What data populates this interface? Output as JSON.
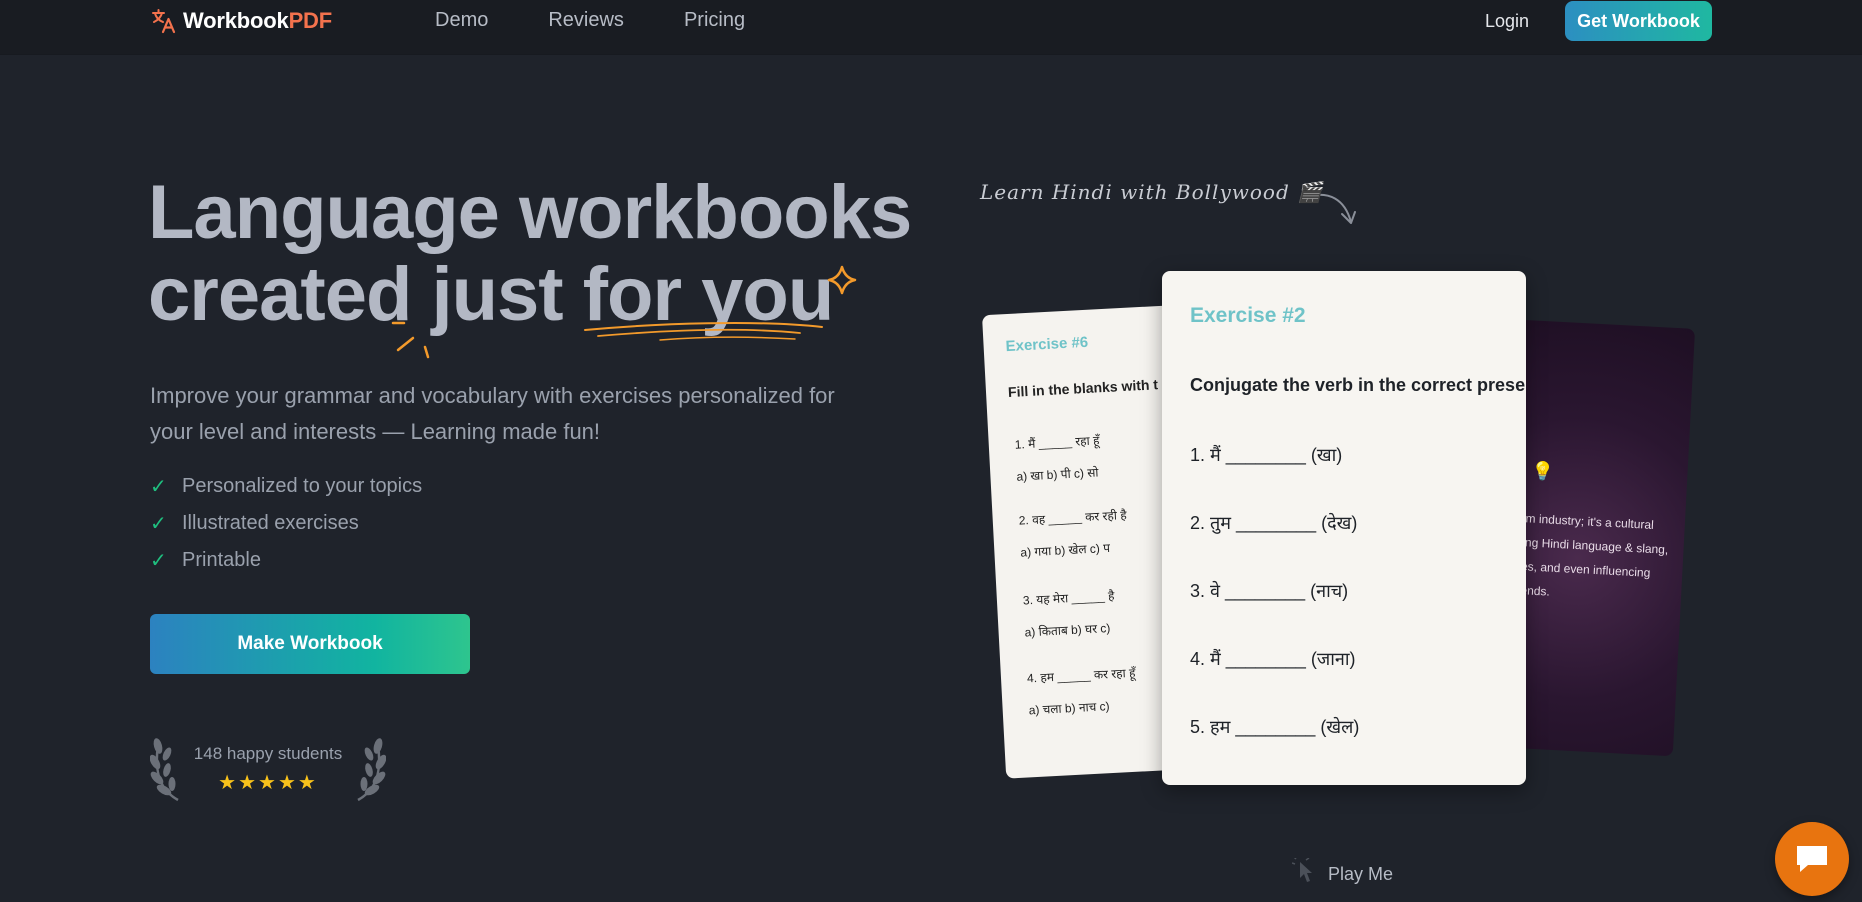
{
  "nav": {
    "logo_prefix": "Workbook",
    "logo_accent": "PDF",
    "links": [
      "Demo",
      "Reviews",
      "Pricing"
    ],
    "login": "Login",
    "cta": "Get Workbook"
  },
  "hero": {
    "headline_line1": "Language workbooks",
    "headline_line2": "created just for you",
    "subtitle": "Improve your grammar and vocabulary with exercises personalized for your level and interests — Learning made fun!",
    "features": [
      "Personalized to your topics",
      "Illustrated exercises",
      "Printable"
    ],
    "cta": "Make Workbook",
    "students": "148 happy students",
    "stars": "★★★★★"
  },
  "preview": {
    "handwritten": "Learn Hindi with Bollywood 🎬",
    "card_left": {
      "title": "Exercise #6",
      "instruction": "Fill in the blanks with t",
      "questions": [
        {
          "q": "1.  मैं _____ रहा हूँ",
          "opts": "a) खा    b) पी    c) सो"
        },
        {
          "q": "2.  वह _____ कर रही है",
          "opts": "a) गया    b) खेल    c) प"
        },
        {
          "q": "3.  यह मेरा _____ है",
          "opts": "a) किताब    b) घर    c)"
        },
        {
          "q": "4.  हम _____ कर रहा हूँ",
          "opts": "a) चला    b) नाच    c)"
        }
      ]
    },
    "card_main": {
      "title": "Exercise #2",
      "instruction": "Conjugate the verb in the correct prese",
      "items": [
        "1.   मैं ________ (खा)",
        "2.   तुम ________ (देख)",
        "3.   वे ________ (नाच)",
        "4.   मैं ________ (जाना)",
        "5.   हम ________ (खेल)"
      ]
    },
    "card_dark": {
      "text": "film industry; it's a cultural ding Hindi language & slang, ges, and even influencing trends."
    },
    "play_me": "Play Me"
  },
  "colors": {
    "background": "#1f232b",
    "accent_orange": "#f3724d",
    "gradient_start": "#2c82c0",
    "gradient_end": "#1fb8a1",
    "check_green": "#1fbf7f",
    "star_yellow": "#f8c21b",
    "chat_orange": "#e8740f"
  }
}
